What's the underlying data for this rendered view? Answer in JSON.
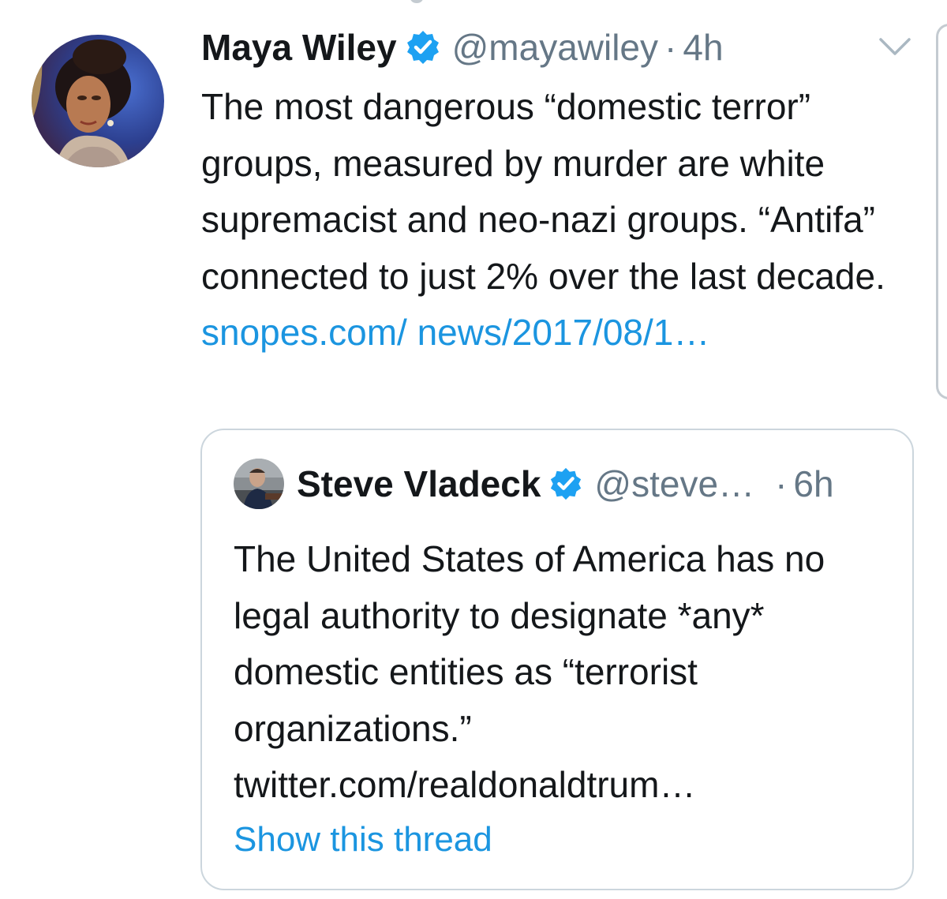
{
  "tweet": {
    "author_name": "Maya Wiley",
    "handle": "@mayawiley",
    "separator": "·",
    "time": "4h",
    "body_text": "The most dangerous “domestic terror” groups, measured by murder are white supremacist and neo-nazi groups. “Antifa” connected to just 2% over the last decade.",
    "link_text": "snopes.com/ news/2017/08/1…"
  },
  "quoted_tweet": {
    "author_name": "Steve Vladeck",
    "handle": "@steve…",
    "separator": "·",
    "time": "6h",
    "body_text": "The United States of America has no legal authority to designate *any* domestic entities as “terrorist organizations.” twitter.com/realdonaldtrum…",
    "show_thread_label": "Show this thread"
  },
  "colors": {
    "link": "#1b95e0",
    "verified": "#1da1f2",
    "secondary_text": "#657786",
    "border": "#ccd6dd"
  },
  "icons": {
    "verified": "verified-badge-icon",
    "menu": "chevron-down-icon"
  }
}
